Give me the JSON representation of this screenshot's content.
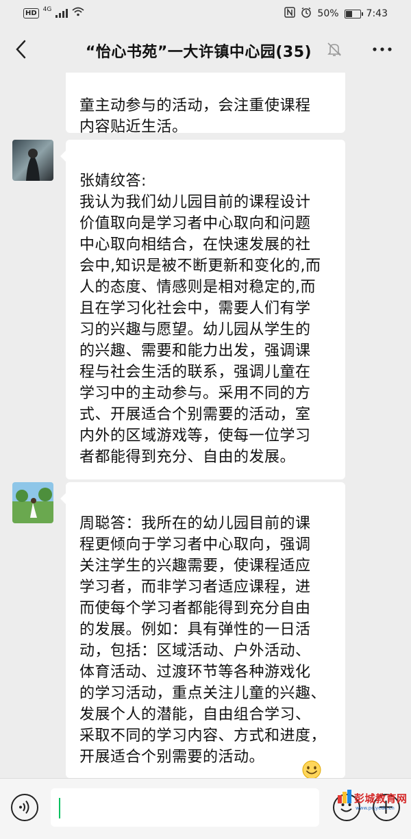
{
  "status_bar": {
    "hd_label": "HD",
    "network_label": "4G",
    "battery_percent": "50%",
    "battery_level": 0.5,
    "time": "7:43",
    "icons": [
      "nfc-icon",
      "alarm-icon",
      "wifi-icon",
      "signal-icon",
      "battery-icon"
    ]
  },
  "header": {
    "title": "“怡心书苑”一大许镇中心园(35)",
    "back_icon": "back-arrow-icon",
    "mute_icon": "mute-bell-icon",
    "more_icon": "more-dots-icon"
  },
  "messages": [
    {
      "text": "童主动参与的活动，会注重使课程\n内容贴近生活。"
    },
    {
      "avatar": "avatar-dark-portrait",
      "text": "张婧纹答:\n我认为我们幼儿园目前的课程设计\n价值取向是学习者中心取向和问题\n中心取向相结合，在快速发展的社\n会中,知识是被不断更新和变化的,而\n人的态度、情感则是相对稳定的,而\n且在学习化社会中，需要人们有学\n习的兴趣与愿望。幼儿园从学生的\n的兴趣、需要和能力出发，强调课\n程与社会生活的联系，强调儿童在\n学习中的主动参与。采用不同的方\n式、开展适合个别需要的活动，室\n内外的区域游戏等，使每一位学习\n者都能得到充分、自由的发展。"
    },
    {
      "avatar": "avatar-girl-in-field",
      "text": "周聪答：我所在的幼儿园目前的课\n程更倾向于学习者中心取向，强调\n关注学生的兴趣需要，使课程适应\n学习者，而非学习者适应课程，进\n而使每个学习者都能得到充分自由\n的发展。例如：具有弹性的一日活\n动，包括：区域活动、户外活动、\n体育活动、过渡环节等各种游戏化\n的学习活动，重点关注儿童的兴趣、\n发展个人的潜能，自由组合学习、\n采取不同的学习内容、方式和进度，\n开展适合个别需要的活动。",
      "emoji": "smile-emoji"
    }
  ],
  "input_bar": {
    "voice_icon": "voice-icon",
    "emoji_icon": "emoji-icon",
    "plus_icon": "plus-icon",
    "message_value": ""
  },
  "watermark": {
    "text": "彭城教育网",
    "sub": "www.pcjyedu.cn"
  },
  "colors": {
    "chat_background": "#ededed",
    "bubble": "#ffffff",
    "caret": "#07c160",
    "watermark_red": "#d52a2a"
  }
}
